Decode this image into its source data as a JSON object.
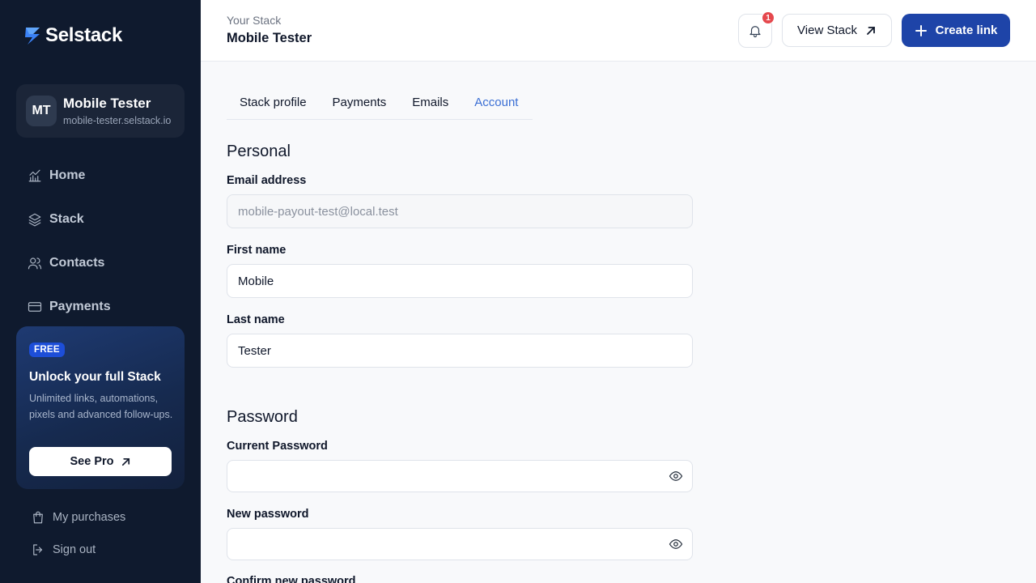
{
  "brand": {
    "name": "Selstack"
  },
  "profile": {
    "initials": "MT",
    "name": "Mobile Tester",
    "url": "mobile-tester.selstack.io"
  },
  "nav": [
    {
      "label": "Home",
      "icon": "chart-icon"
    },
    {
      "label": "Stack",
      "icon": "layers-icon"
    },
    {
      "label": "Contacts",
      "icon": "users-icon"
    },
    {
      "label": "Payments",
      "icon": "card-icon"
    }
  ],
  "promo": {
    "badge": "FREE",
    "title": "Unlock your full Stack",
    "description": "Unlimited links, automations, pixels and advanced follow-ups.",
    "button": "See Pro"
  },
  "footer": {
    "purchases": "My purchases",
    "signout": "Sign out"
  },
  "header": {
    "eyebrow": "Your Stack",
    "title": "Mobile Tester",
    "notification_count": "1",
    "view_button": "View Stack",
    "create_button": "Create link"
  },
  "tabs": [
    {
      "label": "Stack profile",
      "active": false
    },
    {
      "label": "Payments",
      "active": false
    },
    {
      "label": "Emails",
      "active": false
    },
    {
      "label": "Account",
      "active": true
    }
  ],
  "personal": {
    "title": "Personal",
    "email_label": "Email address",
    "email_value": "mobile-payout-test@local.test",
    "first_label": "First name",
    "first_value": "Mobile",
    "last_label": "Last name",
    "last_value": "Tester"
  },
  "password": {
    "title": "Password",
    "current_label": "Current Password",
    "new_label": "New password",
    "confirm_label": "Confirm new password"
  },
  "colors": {
    "sidebar_bg": "#0f1a2e",
    "accent": "#1e44a8",
    "active_tab": "#3b6fd4",
    "badge": "#e5484d"
  }
}
